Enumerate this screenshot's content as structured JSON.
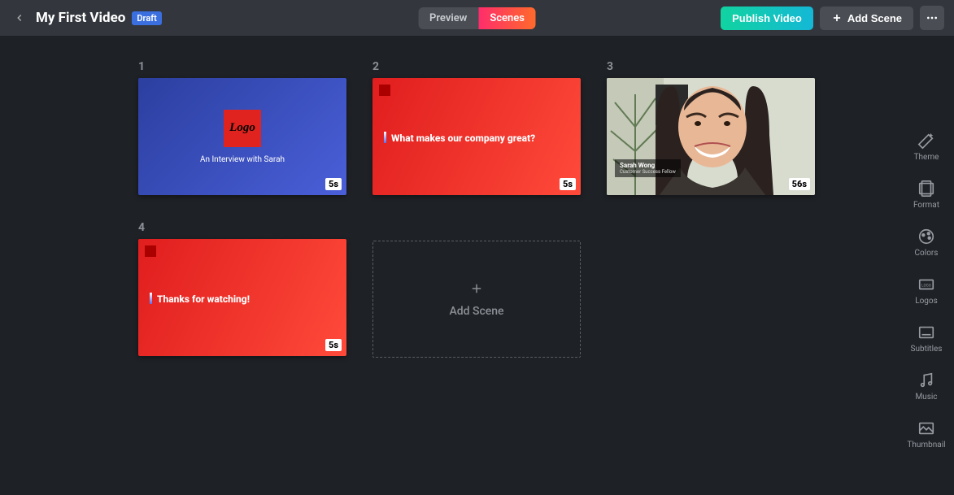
{
  "header": {
    "title": "My First Video",
    "badge": "Draft",
    "tabs": {
      "preview": "Preview",
      "scenes": "Scenes"
    },
    "publish": "Publish Video",
    "add_scene": "Add Scene"
  },
  "scenes": [
    {
      "num": "1",
      "type": "blue",
      "logo": "Logo",
      "subtitle": "An Interview with Sarah",
      "duration": "5s"
    },
    {
      "num": "2",
      "type": "red",
      "text": "What makes our company great?",
      "duration": "5s"
    },
    {
      "num": "3",
      "type": "person",
      "name": "Sarah Wong",
      "role": "Customer Success Fellow",
      "duration": "56s"
    },
    {
      "num": "4",
      "type": "red",
      "text": "Thanks for watching!",
      "duration": "5s"
    }
  ],
  "add_card": "Add Scene",
  "sidebar": [
    {
      "id": "theme",
      "label": "Theme"
    },
    {
      "id": "format",
      "label": "Format"
    },
    {
      "id": "colors",
      "label": "Colors"
    },
    {
      "id": "logos",
      "label": "Logos"
    },
    {
      "id": "subtitles",
      "label": "Subtitles"
    },
    {
      "id": "music",
      "label": "Music"
    },
    {
      "id": "thumbnail",
      "label": "Thumbnail"
    }
  ]
}
